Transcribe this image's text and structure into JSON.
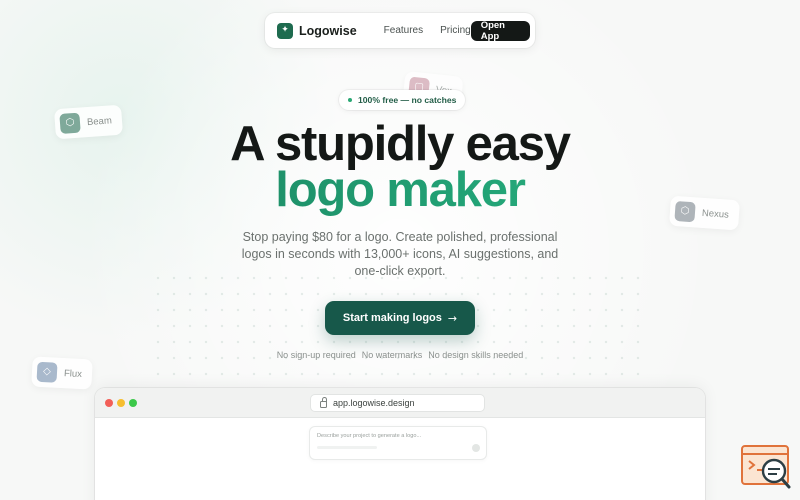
{
  "nav": {
    "brand": "Logowise",
    "links": [
      {
        "label": "Features"
      },
      {
        "label": "Pricing"
      }
    ],
    "cta": "Open App"
  },
  "floating_chips": [
    {
      "label": "Beam",
      "icon": "hexagon-icon"
    },
    {
      "label": "Vox",
      "icon": "square-icon"
    },
    {
      "label": "Nexus",
      "icon": "hexagon-icon"
    },
    {
      "label": "Flux",
      "icon": "drop-icon"
    }
  ],
  "hero": {
    "badge": "100% free — no catches",
    "title_line1": "A stupidly easy",
    "title_line2": "logo maker",
    "subtitle": "Stop paying $80 for a logo. Create polished, professional logos in seconds with 13,000+ icons, AI suggestions, and one-click export.",
    "cta_label": "Start making logos",
    "cta_arrow": "→",
    "perks": [
      "No sign-up required",
      "No watermarks",
      "No design skills needed"
    ]
  },
  "browser": {
    "url": "app.logowise.design",
    "prompt_placeholder": "Describe your project to generate a logo..."
  },
  "colors": {
    "brand": "#1e6b4f",
    "cta": "#17584a",
    "gradient_start": "#1a7a5a",
    "gradient_end": "#36b988",
    "dark_button": "#141816"
  }
}
